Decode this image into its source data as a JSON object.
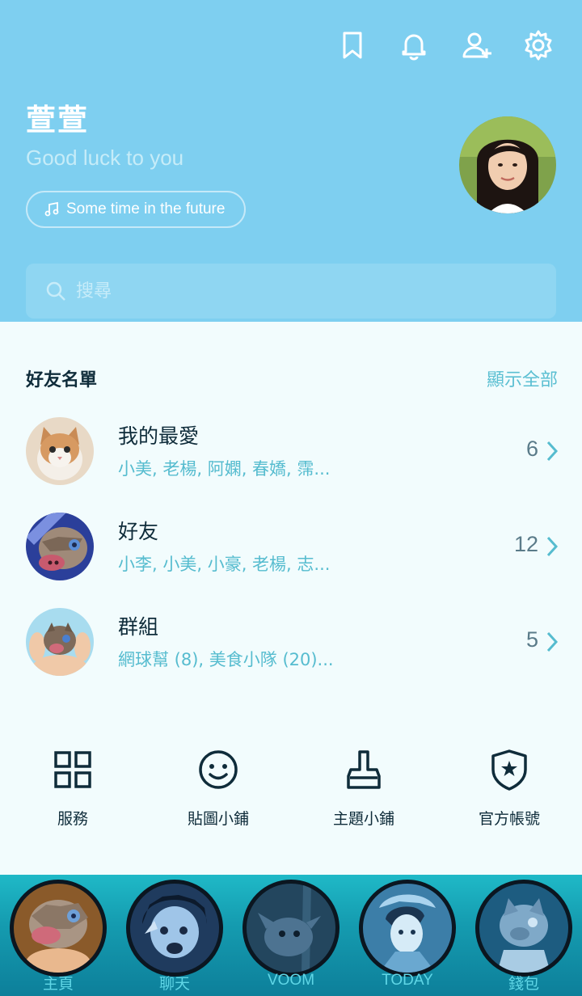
{
  "header": {
    "name": "萱萱",
    "status_message": "Good luck to you",
    "music": "Some time in the future",
    "icons": [
      "bookmark-icon",
      "bell-icon",
      "add-friend-icon",
      "gear-icon"
    ]
  },
  "search": {
    "placeholder": "搜尋"
  },
  "friends_section": {
    "title": "好友名單",
    "show_all": "顯示全部",
    "rows": [
      {
        "title": "我的最愛",
        "subtitle": "小美, 老楊, 阿嫻, 春嬌, 霈...",
        "count": "6"
      },
      {
        "title": "好友",
        "subtitle": "小李, 小美, 小豪, 老楊, 志...",
        "count": "12"
      },
      {
        "title": "群組",
        "subtitle": "網球幫 (8), 美食小隊 (20)...",
        "count": "5"
      }
    ]
  },
  "shortcuts": [
    {
      "label": "服務",
      "icon": "grid-icon"
    },
    {
      "label": "貼圖小鋪",
      "icon": "smiley-icon"
    },
    {
      "label": "主題小鋪",
      "icon": "brush-icon"
    },
    {
      "label": "官方帳號",
      "icon": "shield-star-icon"
    }
  ],
  "tabs": [
    {
      "label": "主頁"
    },
    {
      "label": "聊天"
    },
    {
      "label": "VOOM"
    },
    {
      "label": "TODAY"
    },
    {
      "label": "錢包"
    }
  ],
  "colors": {
    "header_bg": "#7ecff0",
    "accent": "#5bbfd2",
    "text_dark": "#0f2c3a",
    "body_bg": "#f2fcfd"
  }
}
